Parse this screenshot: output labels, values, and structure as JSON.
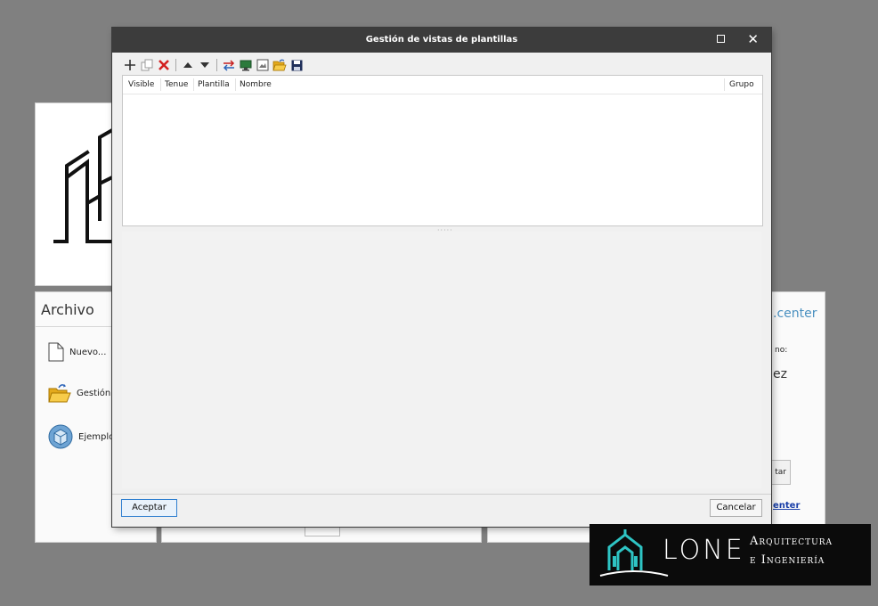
{
  "dialog": {
    "title": "Gestión de vistas de plantillas",
    "toolbar": [
      "add-icon",
      "copy-icon",
      "delete-icon",
      "move-up-icon",
      "move-down-icon",
      "transfer-icon",
      "monitor-icon",
      "image-icon",
      "open-folder-icon",
      "save-icon"
    ],
    "columns": {
      "visible": "Visible",
      "tenue": "Tenue",
      "plantilla": "Plantilla",
      "nombre": "Nombre",
      "grupo": "Grupo"
    },
    "accept_label": "Aceptar",
    "cancel_label": "Cancelar"
  },
  "background": {
    "archivo_title": "Archivo",
    "items": [
      "Nuevo...",
      "Gestión a",
      "Ejemplos"
    ],
    "right_panel": {
      "center": ".center",
      "no": "no:",
      "ez": "ez",
      "button": "tar",
      "link": "enter"
    }
  },
  "watermark": {
    "name": "LONE",
    "line1": "Arquitectura",
    "line2": "e Ingeniería"
  },
  "colors": {
    "titlebar": "#3c3c3c",
    "delete_red": "#d32020",
    "accent_blue": "#2f7fd0",
    "watermark_teal": "#2ec4c4"
  }
}
